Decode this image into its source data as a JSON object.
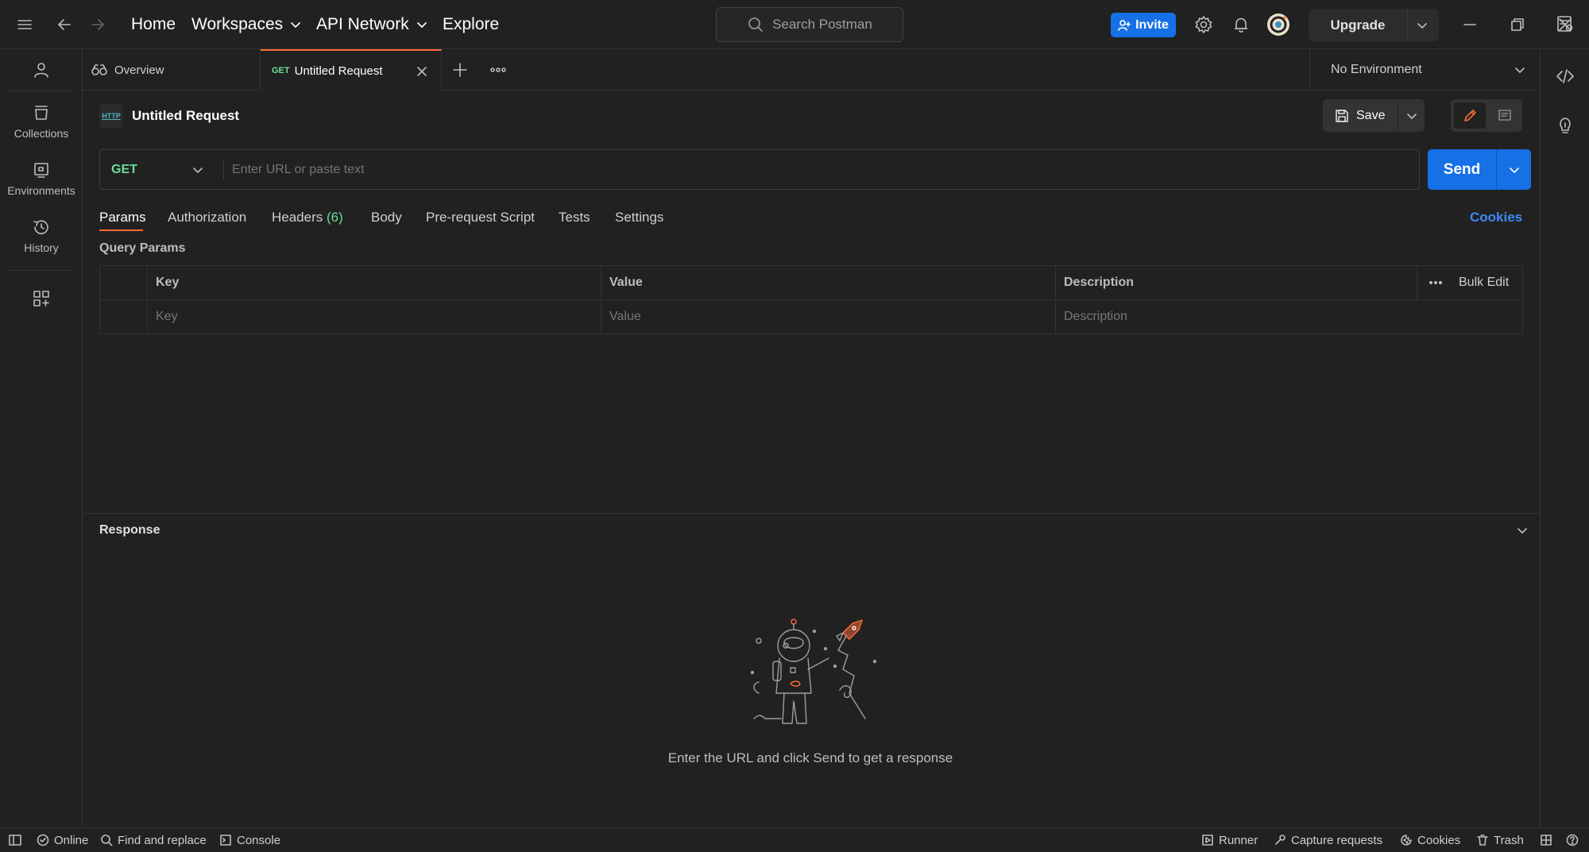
{
  "topbar": {
    "nav": {
      "home": "Home",
      "workspaces": "Workspaces",
      "api_network": "API Network",
      "explore": "Explore"
    },
    "search_placeholder": "Search Postman",
    "invite_label": "Invite",
    "upgrade_label": "Upgrade"
  },
  "sidebar": {
    "items": [
      {
        "label": "Collections"
      },
      {
        "label": "Environments"
      },
      {
        "label": "History"
      }
    ]
  },
  "tabs": {
    "overview_label": "Overview",
    "active": {
      "method": "GET",
      "label": "Untitled Request"
    }
  },
  "environment": {
    "selected": "No Environment"
  },
  "request": {
    "title": "Untitled Request",
    "http_badge": "HTTP",
    "save_label": "Save",
    "method": "GET",
    "url_placeholder": "Enter URL or paste text",
    "send_label": "Send",
    "subtabs": {
      "params": "Params",
      "authorization": "Authorization",
      "headers": "Headers",
      "headers_count": "(6)",
      "body": "Body",
      "prerequest": "Pre-request Script",
      "tests": "Tests",
      "settings": "Settings",
      "cookies": "Cookies"
    },
    "query_params_title": "Query Params",
    "table": {
      "headers": {
        "key": "Key",
        "value": "Value",
        "description": "Description",
        "bulk_edit": "Bulk Edit"
      },
      "placeholders": {
        "key": "Key",
        "value": "Value",
        "description": "Description"
      }
    }
  },
  "response": {
    "title": "Response",
    "empty_message": "Enter the URL and click Send to get a response"
  },
  "statusbar": {
    "online": "Online",
    "find_replace": "Find and replace",
    "console": "Console",
    "runner": "Runner",
    "capture": "Capture requests",
    "cookies": "Cookies",
    "trash": "Trash"
  },
  "colors": {
    "accent": "#ff6c37",
    "primary": "#1670e6",
    "get_method": "#6bdd9a",
    "link": "#3d8af7"
  }
}
